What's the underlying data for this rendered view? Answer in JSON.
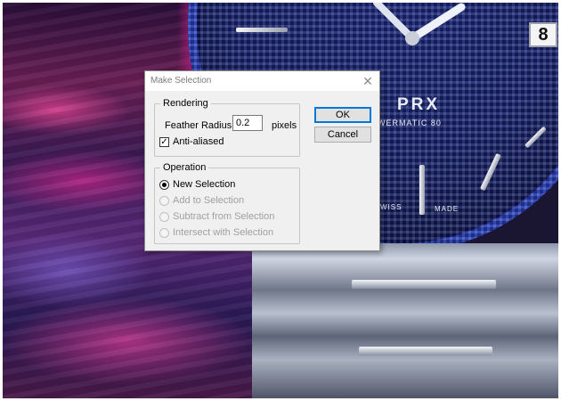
{
  "background": {
    "watch_brand": "PRX",
    "watch_subtext": "WERMATIC 80",
    "dial_text_left": "WISS",
    "dial_text_right": "MADE",
    "date_value": "8"
  },
  "dialog": {
    "title": "Make Selection",
    "close_glyph": "✕",
    "rendering": {
      "legend": "Rendering",
      "feather_label": "Feather Radius:",
      "feather_value": "0.2",
      "feather_unit": "pixels",
      "anti_aliased_label": "Anti-aliased",
      "anti_aliased_checked": true
    },
    "operation": {
      "legend": "Operation",
      "options": [
        {
          "label": "New Selection",
          "selected": true,
          "enabled": true
        },
        {
          "label": "Add to Selection",
          "selected": false,
          "enabled": false
        },
        {
          "label": "Subtract from Selection",
          "selected": false,
          "enabled": false
        },
        {
          "label": "Intersect with Selection",
          "selected": false,
          "enabled": false
        }
      ]
    },
    "buttons": {
      "ok": "OK",
      "cancel": "Cancel"
    }
  },
  "colors": {
    "dialog_bg": "#f0f0f0",
    "default_button_border": "#0078d7",
    "disabled_text": "#a0a0a0"
  }
}
